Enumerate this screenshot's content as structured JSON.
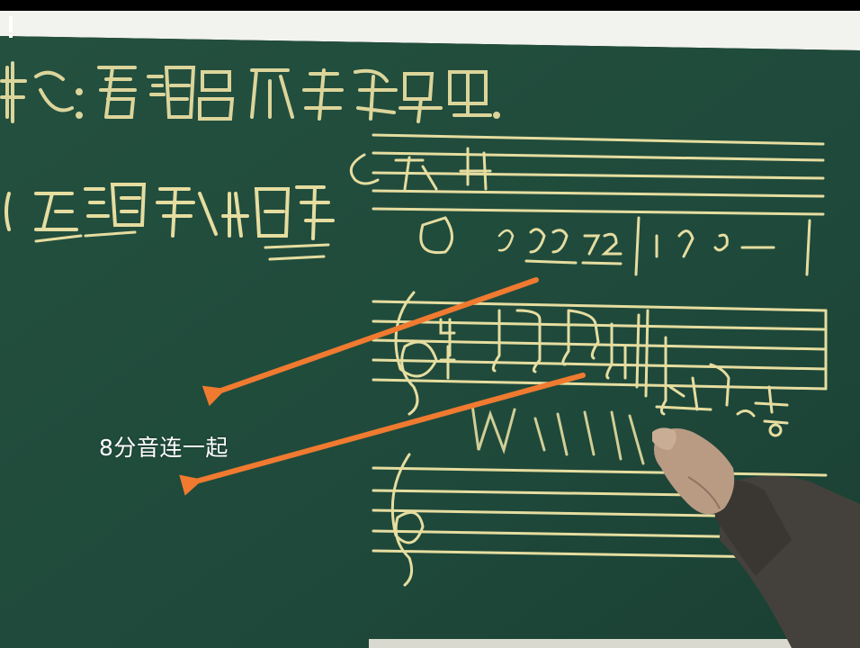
{
  "caption": "8分音连一起",
  "colors": {
    "board": "#1f4a3b",
    "chalk": "#e6dda0",
    "arrow": "#f07a30",
    "caption_text": "#ffffff"
  }
}
